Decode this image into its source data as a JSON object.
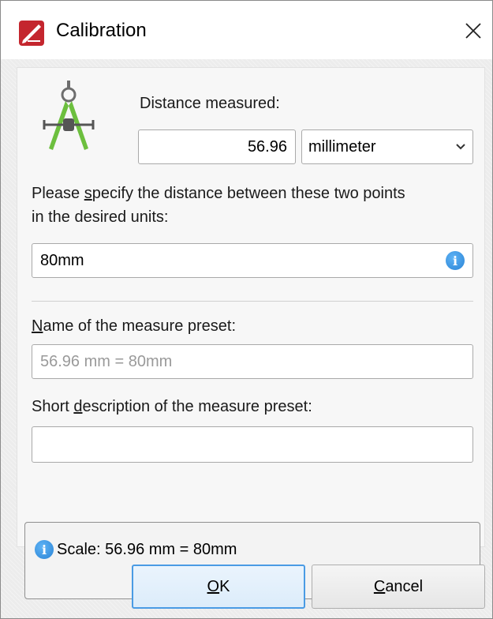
{
  "window": {
    "title": "Calibration"
  },
  "distance": {
    "label": "Distance measured:",
    "value": "56.96",
    "unit": "millimeter"
  },
  "specify": {
    "label_pre": "Please ",
    "label_mn": "s",
    "label_post": "pecify the distance between these two points",
    "label_line2": "in the desired units:",
    "value": "80mm"
  },
  "preset_name": {
    "label_mn": "N",
    "label_post": "ame of the measure preset:",
    "placeholder": "56.96 mm = 80mm"
  },
  "preset_desc": {
    "label_pre": "Short ",
    "label_mn": "d",
    "label_post": "escription of the measure preset:",
    "value": ""
  },
  "scale": {
    "text": "Scale: 56.96 mm = 80mm"
  },
  "buttons": {
    "ok_mn": "O",
    "ok_post": "K",
    "cancel_mn": "C",
    "cancel_post": "ancel"
  },
  "colors": {
    "info_blue": "#2a84d6",
    "app_red": "#c4262e",
    "caliper_green": "#6cbf3e",
    "primary_border": "#4a9be4"
  }
}
